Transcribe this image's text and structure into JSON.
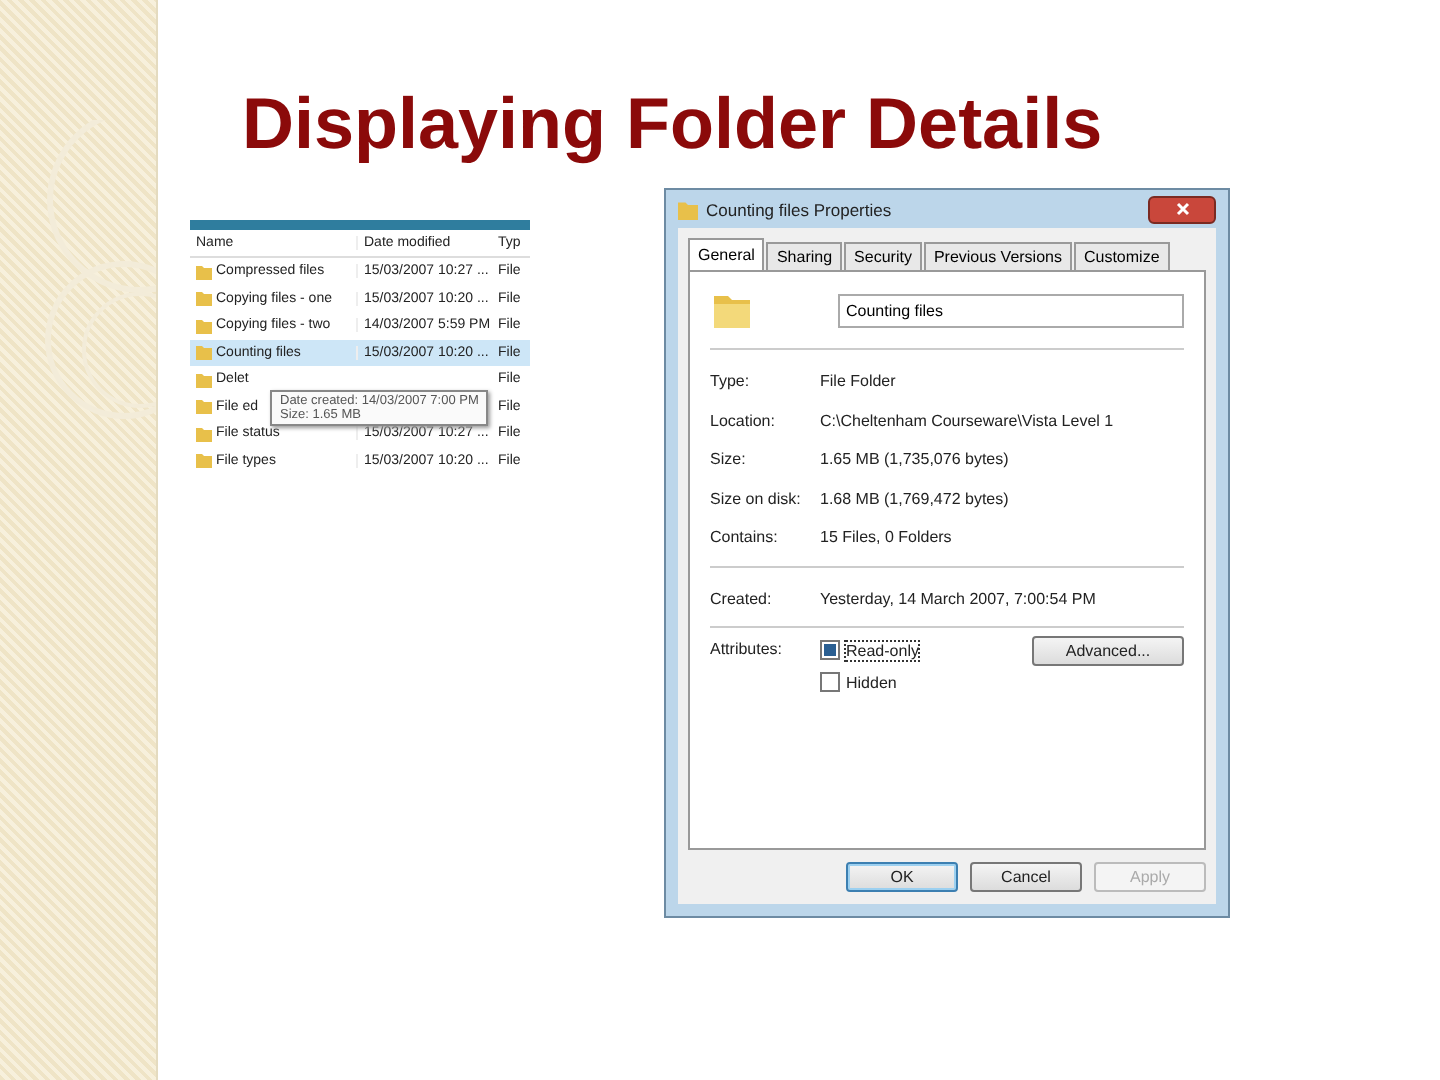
{
  "slide": {
    "title": "Displaying Folder Details"
  },
  "explorer": {
    "columns": [
      "Name",
      "Date modified",
      "Typ"
    ],
    "rows": [
      {
        "name": "Compressed files",
        "date": "15/03/2007 10:27 ...",
        "type": "File",
        "selected": false
      },
      {
        "name": "Copying files - one",
        "date": "15/03/2007 10:20 ...",
        "type": "File",
        "selected": false
      },
      {
        "name": "Copying files - two",
        "date": "14/03/2007 5:59 PM",
        "type": "File",
        "selected": false
      },
      {
        "name": "Counting files",
        "date": "15/03/2007 10:20 ...",
        "type": "File",
        "selected": true
      },
      {
        "name": "Delet",
        "type": "File",
        "selected": false
      },
      {
        "name": "File ed",
        "type": "File",
        "selected": false
      },
      {
        "name": "File status",
        "date": "15/03/2007 10:27 ...",
        "type": "File",
        "selected": false
      },
      {
        "name": "File types",
        "date": "15/03/2007 10:20 ...",
        "type": "File",
        "selected": false
      }
    ],
    "tooltip": [
      "Date created: 14/03/2007 7:00 PM",
      "Size: 1.65 MB"
    ]
  },
  "dialog": {
    "title": "Counting files Properties",
    "tabs": [
      {
        "label": "General",
        "selected": true
      },
      {
        "label": "Sharing",
        "selected": false
      },
      {
        "label": "Security",
        "selected": false
      },
      {
        "label": "Previous Versions",
        "selected": false
      },
      {
        "label": "Customize",
        "selected": false
      }
    ],
    "name_value": "Counting files",
    "groups": [
      [
        {
          "label": "Type:",
          "value": "File Folder"
        },
        {
          "label": "Location:",
          "value": "C:\\Cheltenham Courseware\\Vista Level 1"
        },
        {
          "label": "Size:",
          "value": "1.65 MB (1,735,076 bytes)"
        },
        {
          "label": "Size on disk:",
          "value": "1.68 MB (1,769,472 bytes)"
        },
        {
          "label": "Contains:",
          "value": "15 Files, 0 Folders"
        }
      ],
      [
        {
          "label": "Created:",
          "value": "Yesterday, 14 March 2007, 7:00:54 PM"
        }
      ]
    ],
    "attributes_label": "Attributes:",
    "attributes": [
      {
        "label": "Read-only",
        "checked": true
      },
      {
        "label": "Hidden",
        "checked": false
      }
    ],
    "advanced_button": "Advanced...",
    "buttons": [
      {
        "label": "OK",
        "disabled": false
      },
      {
        "label": "Cancel",
        "disabled": false
      },
      {
        "label": "Apply",
        "disabled": true
      }
    ]
  }
}
